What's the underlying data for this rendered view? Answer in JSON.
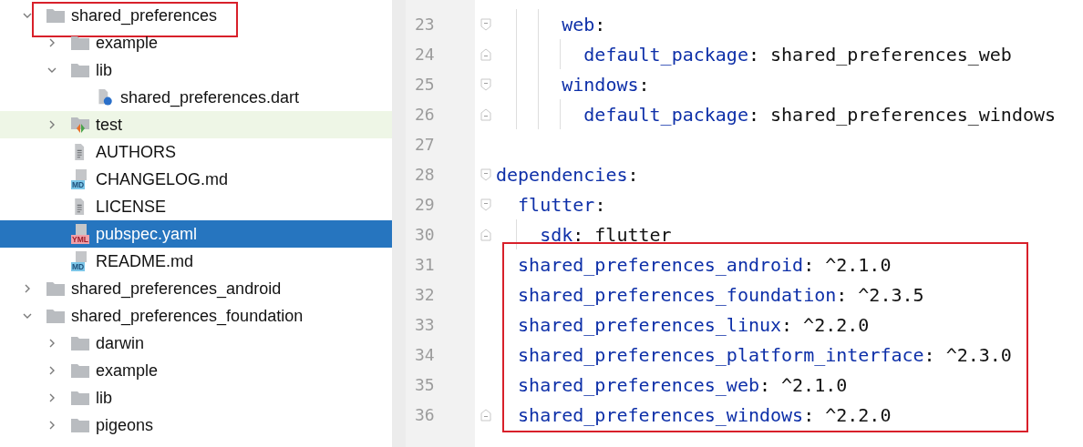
{
  "project_tree": {
    "items": [
      {
        "name": "shared_preferences",
        "kind": "folder",
        "expanded": true,
        "selected": false,
        "boxed": true,
        "children": [
          {
            "name": "example",
            "kind": "folder",
            "expanded": false,
            "selected": false,
            "boxed": false
          },
          {
            "name": "lib",
            "kind": "folder",
            "expanded": true,
            "selected": false,
            "boxed": false,
            "children": [
              {
                "name": "shared_preferences.dart",
                "kind": "dart",
                "selected": false,
                "boxed": false
              }
            ]
          },
          {
            "name": "test",
            "kind": "test_folder",
            "expanded": false,
            "selected": false,
            "boxed": false
          },
          {
            "name": "AUTHORS",
            "kind": "text",
            "selected": false,
            "boxed": false
          },
          {
            "name": "CHANGELOG.md",
            "kind": "badge_file",
            "badge": "MD",
            "selected": false,
            "boxed": false
          },
          {
            "name": "LICENSE",
            "kind": "text",
            "selected": false,
            "boxed": false
          },
          {
            "name": "pubspec.yaml",
            "kind": "badge_file",
            "badge": "YML",
            "selected": true,
            "boxed": false
          },
          {
            "name": "README.md",
            "kind": "badge_file",
            "badge": "MD",
            "selected": false,
            "boxed": false
          }
        ]
      },
      {
        "name": "shared_preferences_android",
        "kind": "folder",
        "expanded": false,
        "selected": false,
        "boxed": false
      },
      {
        "name": "shared_preferences_foundation",
        "kind": "folder",
        "expanded": true,
        "selected": false,
        "boxed": false,
        "children": [
          {
            "name": "darwin",
            "kind": "folder",
            "expanded": false,
            "selected": false,
            "boxed": false
          },
          {
            "name": "example",
            "kind": "folder",
            "expanded": false,
            "selected": false,
            "boxed": false
          },
          {
            "name": "lib",
            "kind": "folder",
            "expanded": false,
            "selected": false,
            "boxed": false
          },
          {
            "name": "pigeons",
            "kind": "folder",
            "expanded": false,
            "selected": false,
            "boxed": false
          }
        ]
      }
    ]
  },
  "editor": {
    "lines": [
      {
        "children": [
          {
            "children": [
              {
                "children": [
                  {
                    "number": "23",
                    "key": "web",
                    "colon": ":",
                    "boxed": false,
                    "children": [
                      {
                        "number": "24",
                        "key": "default_package",
                        "colon": ":",
                        "value": "shared_preferences_web",
                        "boxed": false
                      }
                    ]
                  },
                  {
                    "number": "25",
                    "key": "windows",
                    "colon": ":",
                    "boxed": false,
                    "children": [
                      {
                        "number": "26",
                        "key": "default_package",
                        "colon": ":",
                        "value": "shared_preferences_windows",
                        "boxed": false
                      }
                    ]
                  }
                ]
              }
            ]
          }
        ]
      },
      {
        "number": "27",
        "boxed": false
      },
      {
        "number": "28",
        "key": "dependencies",
        "colon": ":",
        "boxed": false,
        "children": [
          {
            "number": "29",
            "key": "flutter",
            "colon": ":",
            "boxed": false,
            "children": [
              {
                "number": "30",
                "key": "sdk",
                "colon": ":",
                "value": "flutter",
                "boxed": false
              }
            ]
          },
          {
            "number": "31",
            "key": "shared_preferences_android",
            "colon": ":",
            "value": "^2.1.0",
            "boxed": true
          },
          {
            "number": "32",
            "key": "shared_preferences_foundation",
            "colon": ":",
            "value": "^2.3.5",
            "boxed": true
          },
          {
            "number": "33",
            "key": "shared_preferences_linux",
            "colon": ":",
            "value": "^2.2.0",
            "boxed": true
          },
          {
            "number": "34",
            "key": "shared_preferences_platform_interface",
            "colon": ":",
            "value": "^2.3.0",
            "boxed": true
          },
          {
            "number": "35",
            "key": "shared_preferences_web",
            "colon": ":",
            "value": "^2.1.0",
            "boxed": true
          },
          {
            "number": "36",
            "key": "shared_preferences_windows",
            "colon": ":",
            "value": "^2.2.0",
            "boxed": true
          }
        ]
      }
    ]
  }
}
